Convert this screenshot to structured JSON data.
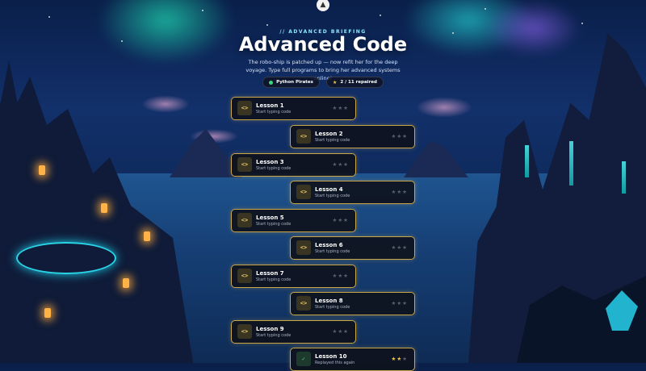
{
  "header": {
    "eyebrow": "// ADVANCED BRIEFING",
    "title": "Advanced Code",
    "subtitle": "The robo-ship is patched up — now refit her for the deep voyage. Type full programs to bring her advanced systems online!"
  },
  "chips": {
    "course": "Python Pirates",
    "progress": "2 / 11 repaired"
  },
  "lesson_icon": "code-brackets-icon",
  "lessons": [
    {
      "title": "Lesson 1",
      "subtitle": "Start typing code",
      "stars": 0,
      "completed": false
    },
    {
      "title": "Lesson 2",
      "subtitle": "Start typing code",
      "stars": 0,
      "completed": false
    },
    {
      "title": "Lesson 3",
      "subtitle": "Start typing code",
      "stars": 0,
      "completed": false
    },
    {
      "title": "Lesson 4",
      "subtitle": "Start typing code",
      "stars": 0,
      "completed": false
    },
    {
      "title": "Lesson 5",
      "subtitle": "Start typing code",
      "stars": 0,
      "completed": false
    },
    {
      "title": "Lesson 6",
      "subtitle": "Start typing code",
      "stars": 0,
      "completed": false
    },
    {
      "title": "Lesson 7",
      "subtitle": "Start typing code",
      "stars": 0,
      "completed": false
    },
    {
      "title": "Lesson 8",
      "subtitle": "Start typing code",
      "stars": 0,
      "completed": false
    },
    {
      "title": "Lesson 9",
      "subtitle": "Start typing code",
      "stars": 0,
      "completed": false
    },
    {
      "title": "Lesson 10",
      "subtitle": "Replayed this again",
      "stars": 2,
      "completed": true
    }
  ],
  "colors": {
    "accent_gold": "#c9a64a",
    "star_on": "#f4c84a",
    "completed_green": "#4fd48c"
  }
}
